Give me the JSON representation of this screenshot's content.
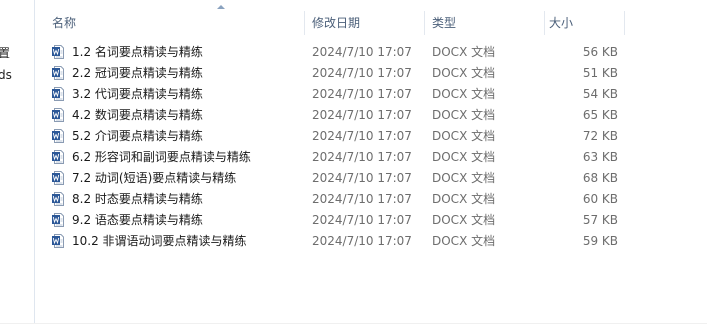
{
  "left_pane": {
    "items": [
      "置",
      "ds"
    ]
  },
  "columns": {
    "name": "名称",
    "date": "修改日期",
    "type": "类型",
    "size": "大小"
  },
  "files": [
    {
      "name": "1.2 名词要点精读与精练",
      "date": "2024/7/10 17:07",
      "type": "DOCX 文档",
      "size": "56 KB",
      "icon": "word-doc-icon"
    },
    {
      "name": "2.2 冠词要点精读与精练",
      "date": "2024/7/10 17:07",
      "type": "DOCX 文档",
      "size": "51 KB",
      "icon": "word-doc-icon"
    },
    {
      "name": "3.2 代词要点精读与精练",
      "date": "2024/7/10 17:07",
      "type": "DOCX 文档",
      "size": "54 KB",
      "icon": "word-doc-icon"
    },
    {
      "name": "4.2 数词要点精读与精练",
      "date": "2024/7/10 17:07",
      "type": "DOCX 文档",
      "size": "65 KB",
      "icon": "word-doc-icon"
    },
    {
      "name": "5.2 介词要点精读与精练",
      "date": "2024/7/10 17:07",
      "type": "DOCX 文档",
      "size": "72 KB",
      "icon": "word-doc-icon"
    },
    {
      "name": "6.2 形容词和副词要点精读与精练",
      "date": "2024/7/10 17:07",
      "type": "DOCX 文档",
      "size": "63 KB",
      "icon": "word-doc-icon"
    },
    {
      "name": "7.2 动词(短语)要点精读与精练",
      "date": "2024/7/10 17:07",
      "type": "DOCX 文档",
      "size": "68 KB",
      "icon": "word-doc-icon"
    },
    {
      "name": "8.2 时态要点精读与精练",
      "date": "2024/7/10 17:07",
      "type": "DOCX 文档",
      "size": "60 KB",
      "icon": "word-doc-icon"
    },
    {
      "name": "9.2 语态要点精读与精练",
      "date": "2024/7/10 17:07",
      "type": "DOCX 文档",
      "size": "57 KB",
      "icon": "word-doc-icon"
    },
    {
      "name": "10.2 非谓语动词要点精读与精练",
      "date": "2024/7/10 17:07",
      "type": "DOCX 文档",
      "size": "59 KB",
      "icon": "word-doc-icon"
    }
  ],
  "colors": {
    "header_text": "#4c607a",
    "meta_text": "#6d6d6d",
    "word_blue": "#2b5797"
  }
}
